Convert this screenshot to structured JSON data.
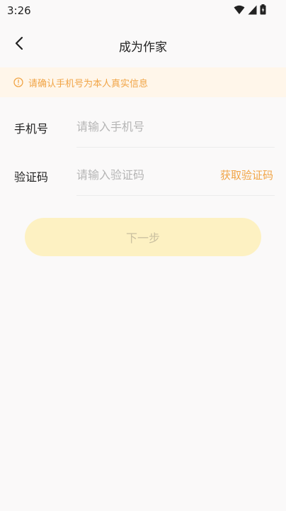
{
  "status_bar": {
    "time": "3:26",
    "icons": [
      "wifi-icon",
      "cell-signal-icon",
      "battery-icon"
    ]
  },
  "header": {
    "back_icon": "chevron-left-icon",
    "title": "成为作家"
  },
  "notice": {
    "icon": "info-circle-icon",
    "text": "请确认手机号为本人真实信息"
  },
  "form": {
    "phone": {
      "label": "手机号",
      "placeholder": "请输入手机号",
      "value": ""
    },
    "code": {
      "label": "验证码",
      "placeholder": "请输入验证码",
      "value": "",
      "get_code_label": "获取验证码"
    }
  },
  "next_button": {
    "label": "下一步",
    "enabled": false
  },
  "colors": {
    "accent": "#f1a445",
    "notice_bg": "#fff6ea",
    "button_disabled_bg": "#fdf1c2",
    "button_disabled_text": "#c9bf9f",
    "page_bg": "#faf9f9"
  }
}
